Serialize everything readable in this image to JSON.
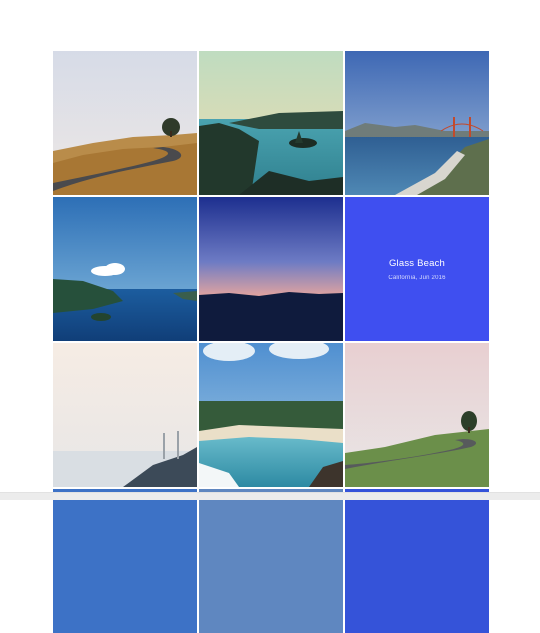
{
  "gallery": {
    "overlay_title": "Glass Beach",
    "overlay_subtitle": "California, Jun 2016",
    "accent": "#3f4ff0"
  }
}
